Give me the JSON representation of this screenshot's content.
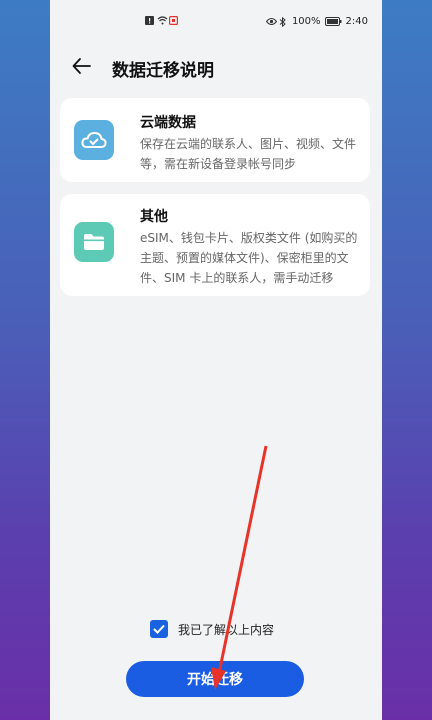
{
  "status_bar": {
    "battery": "100%",
    "time": "2:40"
  },
  "header": {
    "title": "数据迁移说明"
  },
  "cards": [
    {
      "icon": "cloud-icon",
      "title": "云端数据",
      "description": "保存在云端的联系人、图片、视频、文件等，需在新设备登录帐号同步"
    },
    {
      "icon": "folder-icon",
      "title": "其他",
      "description": "eSIM、钱包卡片、版权类文件 (如购买的主题、预置的媒体文件)、保密柜里的文件、SIM 卡上的联系人，需手动迁移"
    }
  ],
  "agreement": {
    "label": "我已了解以上内容",
    "checked": true
  },
  "primary_button": {
    "label": "开始迁移"
  },
  "colors": {
    "accent": "#1a5de2",
    "cloud_icon_bg": "#5bb0e0",
    "folder_icon_bg": "#5ccab4",
    "annotation_arrow": "#e8332a"
  }
}
